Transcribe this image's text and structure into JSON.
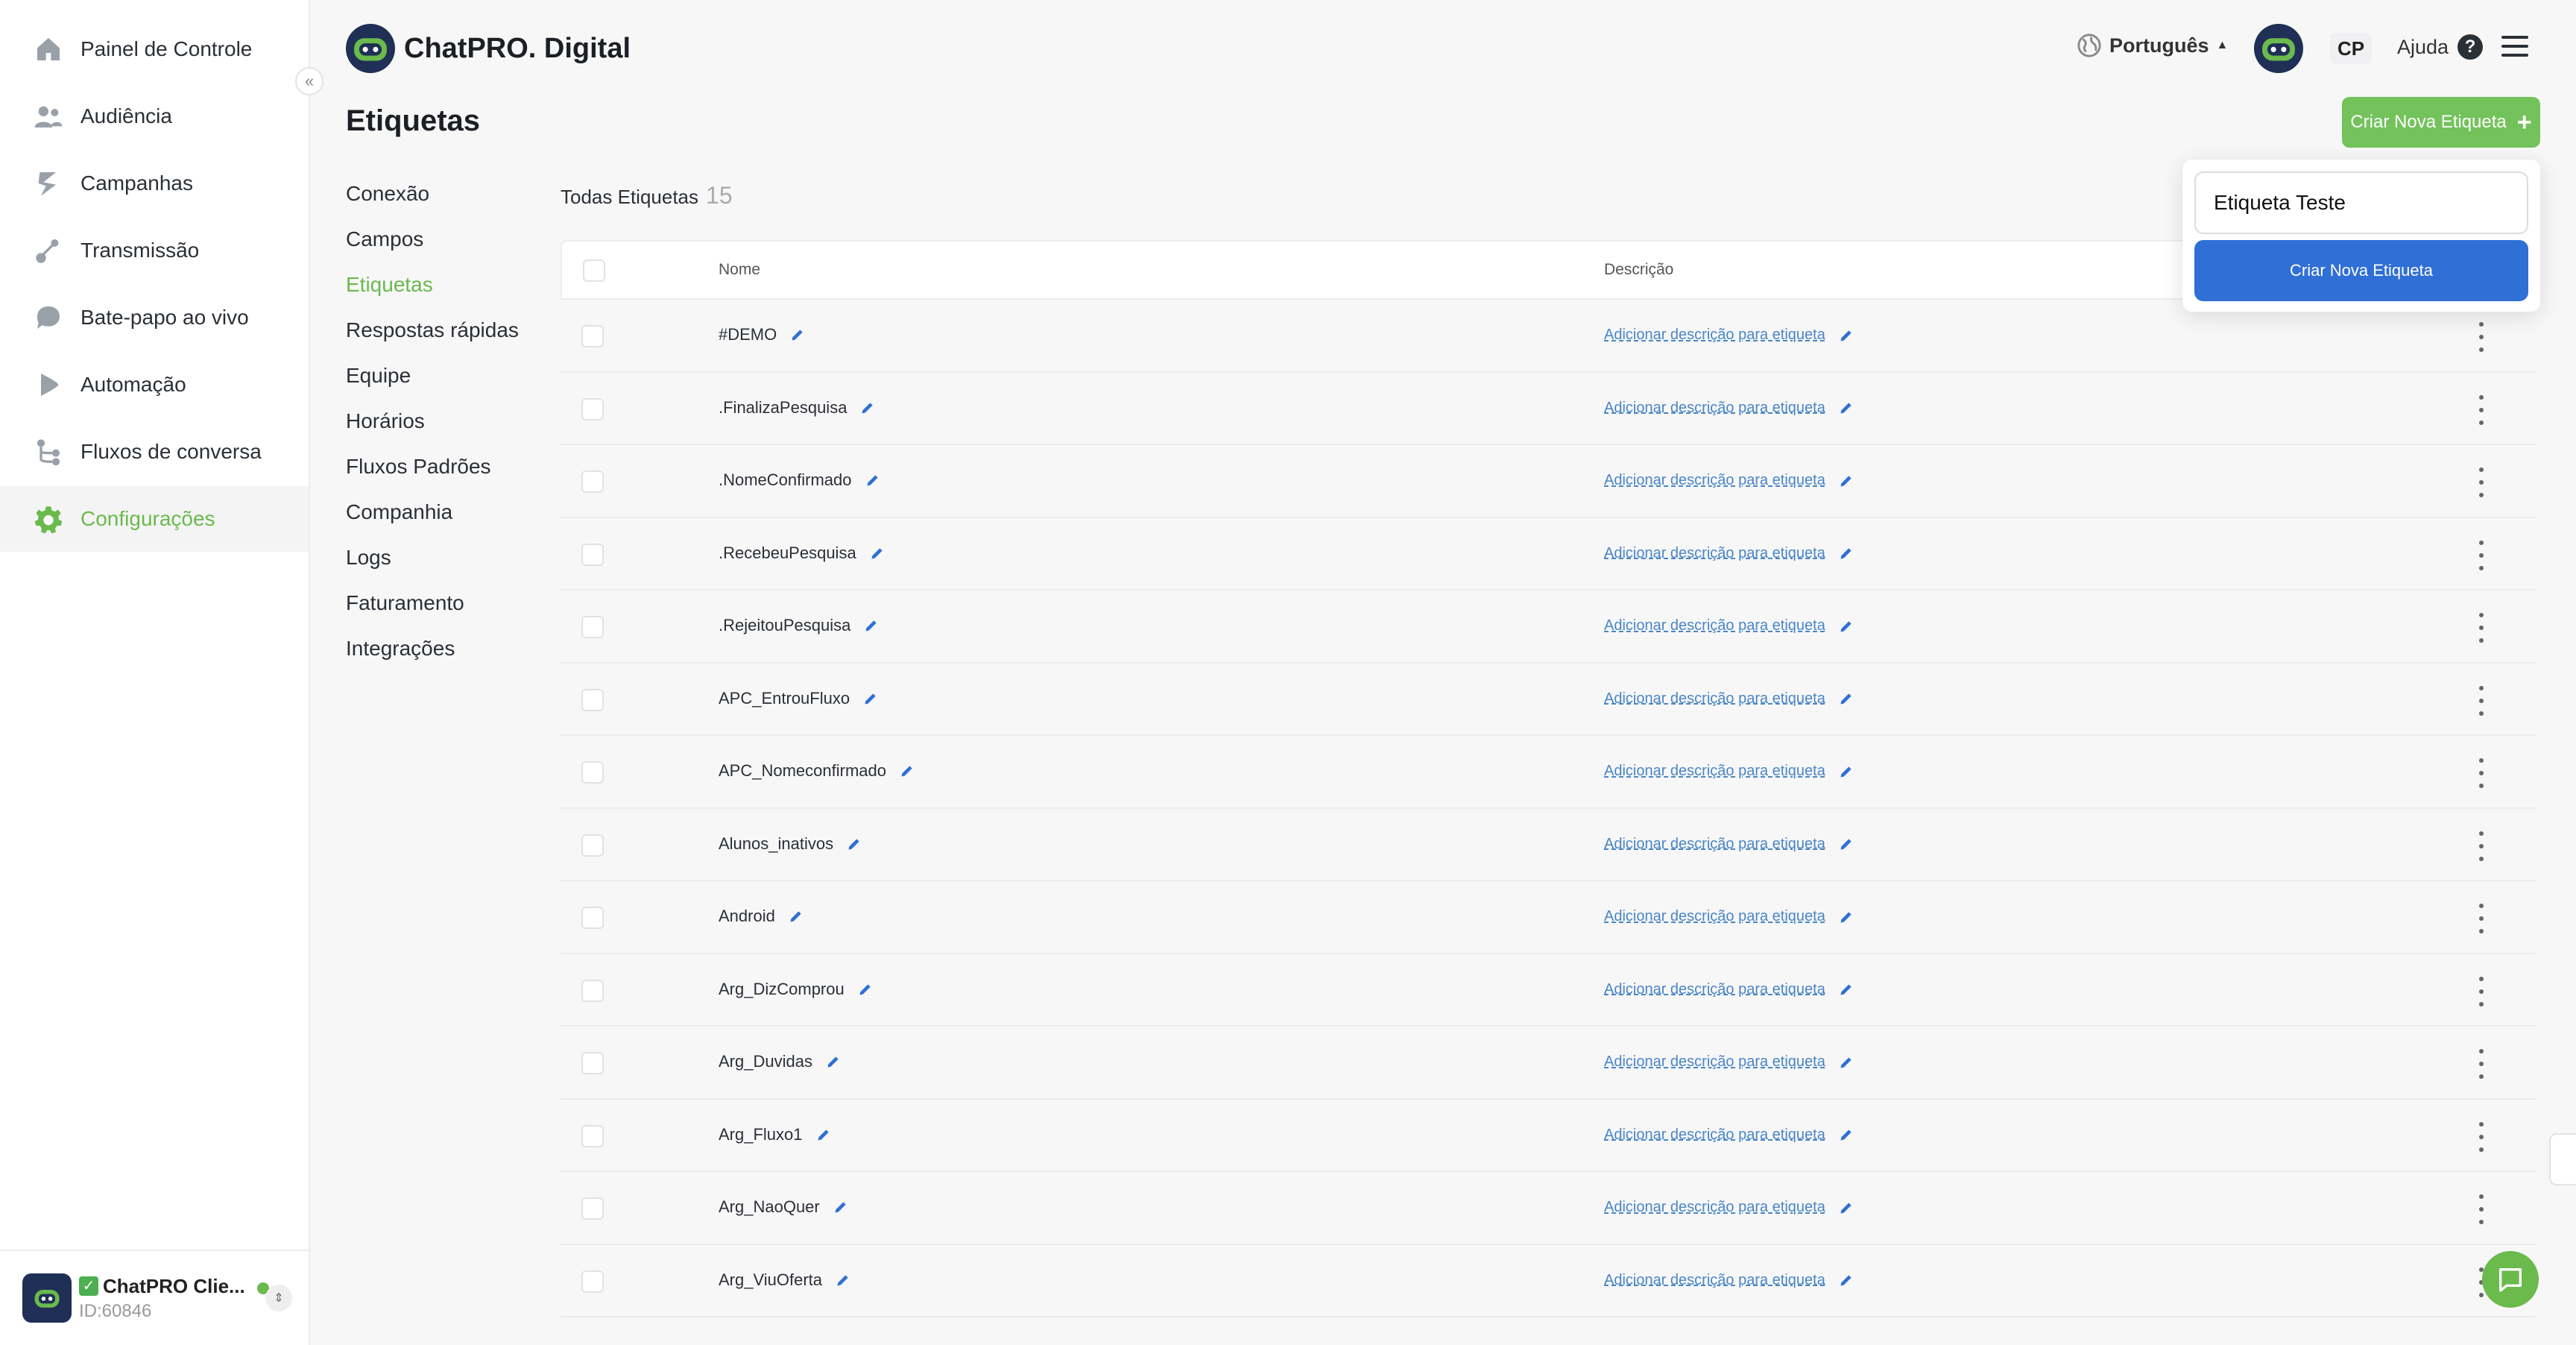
{
  "app": {
    "brand_name": "ChatPRO. Digital",
    "accent_color": "#6aba4c",
    "primary_color": "#2f6fd6"
  },
  "sidebar": {
    "items": [
      {
        "label": "Painel de Controle",
        "icon": "home-icon"
      },
      {
        "label": "Audiência",
        "icon": "users-icon"
      },
      {
        "label": "Campanhas",
        "icon": "campaign-icon"
      },
      {
        "label": "Transmissão",
        "icon": "broadcast-icon"
      },
      {
        "label": "Bate-papo ao vivo",
        "icon": "chat-icon"
      },
      {
        "label": "Automação",
        "icon": "play-icon"
      },
      {
        "label": "Fluxos de conversa",
        "icon": "flow-icon"
      },
      {
        "label": "Configurações",
        "icon": "gear-icon",
        "active": true
      }
    ],
    "account": {
      "name": "ChatPRO Clie...",
      "id": "ID:60846"
    }
  },
  "header": {
    "language": "Português",
    "initials": "CP",
    "help_label": "Ajuda",
    "help_icon_text": "?"
  },
  "page": {
    "title": "Etiquetas",
    "create_button": "Criar Nova Etiqueta",
    "create_plus": "+"
  },
  "settings_menu": [
    {
      "label": "Conexão"
    },
    {
      "label": "Campos"
    },
    {
      "label": "Etiquetas",
      "active": true
    },
    {
      "label": "Respostas rápidas"
    },
    {
      "label": "Equipe"
    },
    {
      "label": "Horários"
    },
    {
      "label": "Fluxos Padrões"
    },
    {
      "label": "Companhia"
    },
    {
      "label": "Logs"
    },
    {
      "label": "Faturamento"
    },
    {
      "label": "Integrações"
    }
  ],
  "list": {
    "title": "Todas Etiquetas",
    "count": "15",
    "columns": {
      "name": "Nome",
      "description": "Descrição"
    },
    "add_description_label": "Adicionar descrição para etiqueta",
    "rows": [
      {
        "name": "#DEMO"
      },
      {
        "name": ".FinalizaPesquisa"
      },
      {
        "name": ".NomeConfirmado"
      },
      {
        "name": ".RecebeuPesquisa"
      },
      {
        "name": ".RejeitouPesquisa"
      },
      {
        "name": "APC_EntrouFluxo"
      },
      {
        "name": "APC_Nomeconfirmado"
      },
      {
        "name": "Alunos_inativos"
      },
      {
        "name": "Android"
      },
      {
        "name": "Arg_DizComprou"
      },
      {
        "name": "Arg_Duvidas"
      },
      {
        "name": "Arg_Fluxo1"
      },
      {
        "name": "Arg_NaoQuer"
      },
      {
        "name": "Arg_ViuOferta"
      }
    ]
  },
  "popover": {
    "input_value": "Etiqueta Teste",
    "submit_label": "Criar Nova Etiqueta"
  }
}
